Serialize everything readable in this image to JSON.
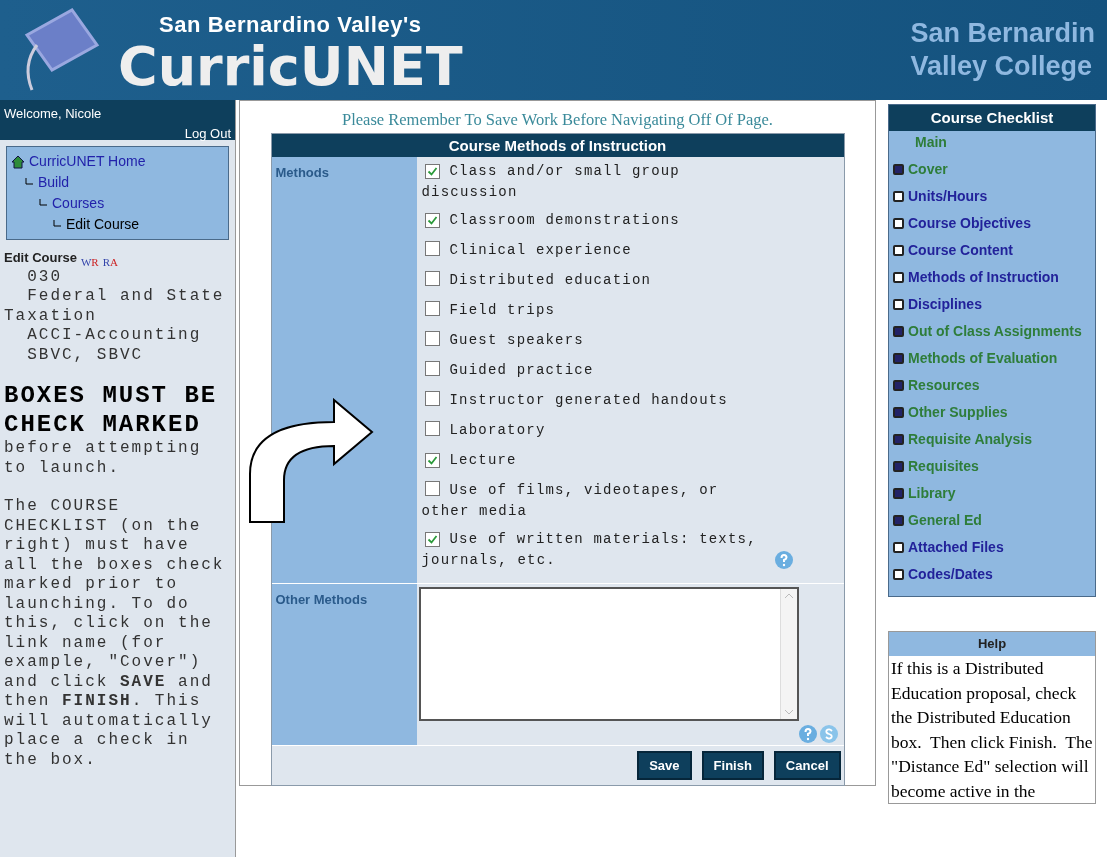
{
  "header": {
    "subtitle": "San Bernardino Valley's",
    "title": "CurricUNET",
    "college_line_1": "San Bernardin",
    "college_line_2": "Valley College"
  },
  "sidebar": {
    "welcome": "Welcome, Nicole",
    "logout": "Log Out",
    "nav": [
      {
        "label": "CurricUNET Home",
        "children": [
          {
            "label": "Build",
            "children": [
              {
                "label": "Courses",
                "children": [
                  {
                    "label": "Edit Course"
                  }
                ]
              }
            ]
          }
        ]
      }
    ],
    "edit_course": {
      "title": "Edit Course",
      "badge_1": "W",
      "badge_1b": "R",
      "badge_2": "R",
      "badge_2b": "A",
      "lines": [
        "  030",
        "  Federal and State Taxation",
        "  ACCI-Accounting",
        "  SBVC, SBVC"
      ]
    },
    "warning_title": "BOXES MUST BE CHECK MARKED",
    "warning_text": "before attempting to launch.",
    "instructions": "The COURSE CHECKLIST (on the right) must have all the boxes check marked prior to launching. To do this, click on the link name (for example, \"Cover\") and click **SAVE** and then **FINISH**. This will automatically place a check in the box."
  },
  "notice": "Please Remember To Save Work Before Navigating Off Of Page.",
  "form": {
    "title": "Course Methods of Instruction",
    "methods_label": "Methods",
    "methods": [
      {
        "label": "Class and/or small group discussion",
        "checked": true
      },
      {
        "label": "Classroom demonstrations",
        "checked": true
      },
      {
        "label": "Clinical experience",
        "checked": false
      },
      {
        "label": "Distributed education",
        "checked": false
      },
      {
        "label": "Field trips",
        "checked": false
      },
      {
        "label": "Guest speakers",
        "checked": false
      },
      {
        "label": "Guided practice",
        "checked": false
      },
      {
        "label": "Instructor generated handouts",
        "checked": false
      },
      {
        "label": "Laboratory",
        "checked": false
      },
      {
        "label": "Lecture",
        "checked": true
      },
      {
        "label": "Use of films, videotapes, or other media",
        "checked": false
      },
      {
        "label": "Use of written materials: texts, journals, etc.",
        "checked": true
      }
    ],
    "other_label": "Other Methods",
    "buttons": [
      "Save",
      "Finish",
      "Cancel"
    ]
  },
  "checklist": {
    "title": "Course Checklist",
    "items": [
      {
        "kind": "heading",
        "label": "Main",
        "checked": true
      },
      {
        "kind": "item",
        "label": "Cover",
        "checked": true
      },
      {
        "kind": "item",
        "label": "Units/Hours",
        "checked": false
      },
      {
        "kind": "item",
        "label": "Course Objectives",
        "checked": false
      },
      {
        "kind": "item",
        "label": "Course Content",
        "checked": false
      },
      {
        "kind": "item",
        "label": "Methods of Instruction",
        "checked": false
      },
      {
        "kind": "item",
        "label": "Disciplines",
        "checked": false
      },
      {
        "kind": "item",
        "label": "Out of Class Assignments",
        "checked": true
      },
      {
        "kind": "item",
        "label": "Methods of Evaluation",
        "checked": true
      },
      {
        "kind": "item",
        "label": "Resources",
        "checked": true
      },
      {
        "kind": "item",
        "label": "Other Supplies",
        "checked": true
      },
      {
        "kind": "item",
        "label": "Requisite Analysis",
        "checked": true
      },
      {
        "kind": "item",
        "label": "Requisites",
        "checked": true
      },
      {
        "kind": "item",
        "label": "Library",
        "checked": true
      },
      {
        "kind": "item",
        "label": "General Ed",
        "checked": true
      },
      {
        "kind": "item",
        "label": "Attached Files",
        "checked": false
      },
      {
        "kind": "item",
        "label": "Codes/Dates",
        "checked": false
      }
    ]
  },
  "help": {
    "title": "Help",
    "text": "If this is a Distributed Education proposal, check the Distributed Education box.  Then click Finish.  The \"Distance Ed\" selection will become active in the"
  }
}
